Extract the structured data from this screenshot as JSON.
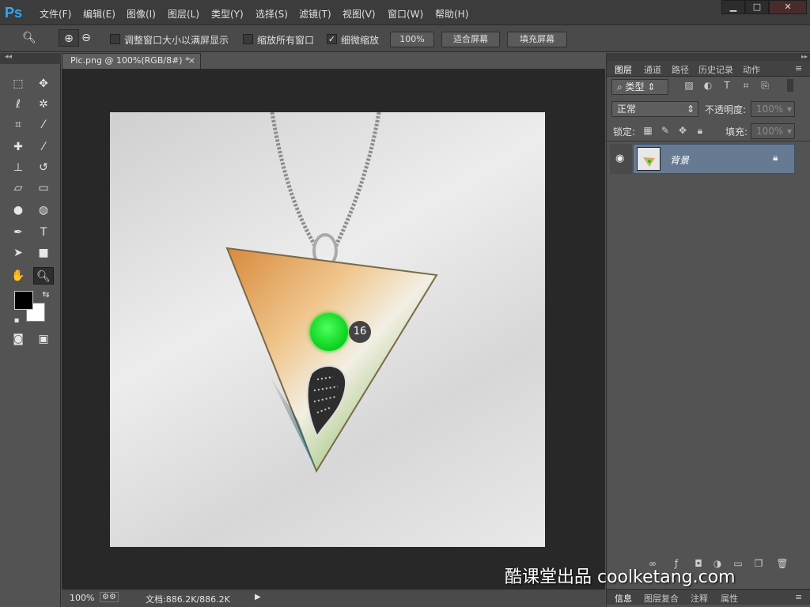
{
  "app": {
    "logo": "Ps"
  },
  "menu": [
    "文件(F)",
    "编辑(E)",
    "图像(I)",
    "图层(L)",
    "类型(Y)",
    "选择(S)",
    "滤镜(T)",
    "视图(V)",
    "窗口(W)",
    "帮助(H)"
  ],
  "window_controls": {
    "minimize": "▁",
    "maximize": "□",
    "close": "✕"
  },
  "options": {
    "tool_icon": "zoom-icon",
    "resize_windows_label": "调整窗口大小以满屏显示",
    "zoom_all_label": "缩放所有窗口",
    "scrubby_zoom_label": "细微缩放",
    "scrubby_zoom_checked": true,
    "btn_100": "100%",
    "btn_fit": "适合屏幕",
    "btn_fill": "填充屏幕"
  },
  "document": {
    "tab_title": "Pic.png @ 100%(RGB/8#) *",
    "zoom": "100%",
    "doc_size": "文档:886.2K/886.2K"
  },
  "overlay": {
    "badge": "16",
    "watermark": "酷课堂出品 coolketang.com"
  },
  "layers_panel": {
    "tabs": [
      "图层",
      "通道",
      "路径",
      "历史记录",
      "动作"
    ],
    "active_tab": "图层",
    "filter_kind": "类型",
    "blend_mode": "正常",
    "opacity_label": "不透明度:",
    "opacity_value": "100%",
    "lock_label": "锁定:",
    "fill_label": "填充:",
    "fill_value": "100%",
    "layers": [
      {
        "name": "背景",
        "visible": true,
        "locked": true
      }
    ]
  },
  "bottom_tabs": [
    "信息",
    "图层复合",
    "注释",
    "属性"
  ],
  "colors": {
    "accent": "#31a8ff",
    "selected_layer": "#667a94",
    "green_dot": "#10d321"
  }
}
